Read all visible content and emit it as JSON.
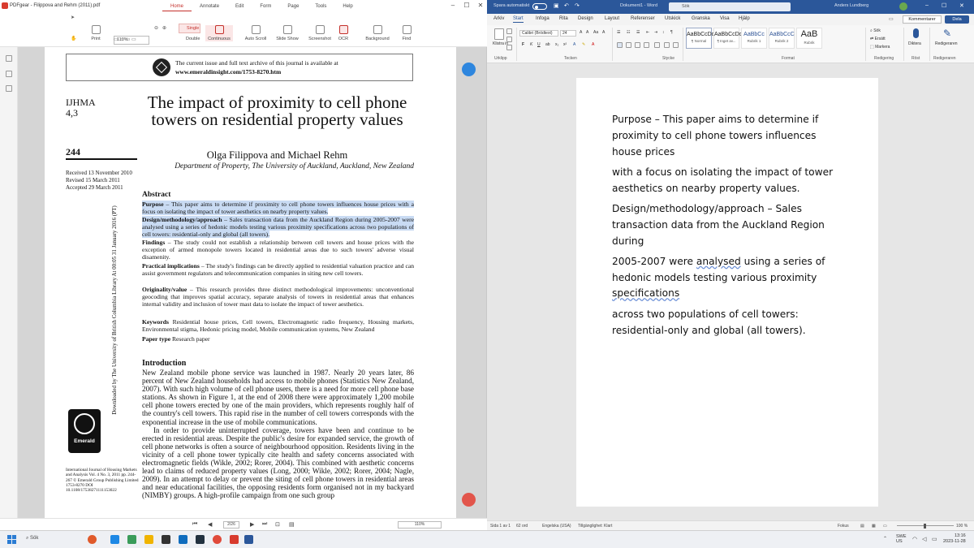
{
  "pdf": {
    "window_title": "PDFgear - Filippova and Rehm (2011).pdf",
    "menu_tabs": [
      "Home",
      "Annotate",
      "Edit",
      "Form",
      "Page",
      "Tools",
      "Help"
    ],
    "active_tab": "Home",
    "toolbar": {
      "print": "Print",
      "zoom": "110%",
      "single": "Single",
      "double": "Double",
      "continuous": "Continuous",
      "auto_scroll": "Auto Scroll",
      "slide_show": "Slide Show",
      "screenshot": "Screenshot",
      "ocr": "OCR",
      "background": "Background",
      "find": "Find"
    },
    "page": {
      "banner_line1": "The current issue and full text archive of this journal is available at",
      "banner_line2": "www.emeraldinsight.com/1753-8270.htm",
      "journal_abbr": "IJHMA",
      "journal_vol": "4,3",
      "page_number": "244",
      "received": "Received 13 November 2010",
      "revised": "Revised 15 March 2011",
      "accepted": "Accepted 29 March 2011",
      "vertical_text": "Downloaded by The University of British Columbia Library At 00:05 31 January 2016 (PT)",
      "title": "The impact of proximity to cell phone towers on residential property values",
      "authors": "Olga Filippova and Michael Rehm",
      "affiliation": "Department of Property, The University of Auckland, Auckland, New Zealand",
      "abstract_heading": "Abstract",
      "purpose_label": "Purpose",
      "purpose_text": " – This paper aims to determine if proximity to cell phone towers influences house prices with a focus on isolating the impact of tower aesthetics on nearby property values.",
      "design_label": "Design/methodology/approach",
      "design_text": " – Sales transaction data from the Auckland Region during 2005-2007 were analysed using a series of hedonic models testing various proximity specifications across two populations of cell towers: residential-only and global (all towers).",
      "findings_label": "Findings",
      "findings_text": " – The study could not establish a relationship between cell towers and house prices with the exception of armed monopole towers located in residential areas due to such towers' adverse visual disamenity.",
      "practical_label": "Practical implications",
      "practical_text": " – The study's findings can be directly applied to residential valuation practice and can assist government regulators and telecommunication companies in siting new cell towers.",
      "originality_label": "Originality/value",
      "originality_text": " – This research provides three distinct methodological improvements: unconventional geocoding that improves spatial accuracy, separate analysis of towers in residential areas that enhances internal validity and inclusion of tower mast data to isolate the impact of tower aesthetics.",
      "keywords_label": "Keywords",
      "keywords_text": " Residential house prices, Cell towers, Electromagnetic radio frequency, Housing markets, Environmental stigma, Hedonic pricing model, Mobile communication systems, New Zealand",
      "paper_type_label": "Paper type",
      "paper_type_text": " Research paper",
      "intro_heading": "Introduction",
      "intro_p1": "New Zealand mobile phone service was launched in 1987. Nearly 20 years later, 86 percent of New Zealand households had access to mobile phones (Statistics New Zealand, 2007). With such high volume of cell phone users, there is a need for more cell phone base stations. As shown in Figure 1, at the end of 2008 there were approximately 1,200 mobile cell phone towers erected by one of the main providers, which represents roughly half of the country's cell towers. This rapid rise in the number of cell towers corresponds with the exponential increase in the use of mobile communications.",
      "intro_p2": "In order to provide uninterrupted coverage, towers have been and continue to be erected in residential areas. Despite the public's desire for expanded service, the growth of cell phone networks is often a source of neighbourhood opposition. Residents living in the vicinity of a cell phone tower typically cite health and safety concerns associated with electromagnetic fields (Wikle, 2002; Rorer, 2004). This combined with aesthetic concerns lead to claims of reduced property values (Long, 2000; Wikle, 2002; Rorer, 2004; Nagle, 2009). In an attempt to delay or prevent the siting of cell phone towers in residential areas and near educational facilities, the opposing residents form organised not in my backyard (NIMBY) groups. A high-profile campaign from one such group",
      "emerald": "Emerald",
      "pub_info": "International Journal of Housing Markets and Analysis Vol. 4 No. 3, 2011 pp. 244-267 © Emerald Group Publishing Limited 1753-8270 DOI 10.1108/17538271111153022"
    },
    "status": {
      "page_current": "2",
      "page_total": "/26",
      "zoom": "110%"
    }
  },
  "word": {
    "autosave_label": "Spara automatiskt",
    "doc_name": "Dokument1 - Word",
    "search_placeholder": "Sök",
    "user": "Anders Lundberg",
    "tabs": [
      "Arkiv",
      "Start",
      "Infoga",
      "Rita",
      "Design",
      "Layout",
      "Referenser",
      "Utskick",
      "Granska",
      "Visa",
      "Hjälp"
    ],
    "active_tab": "Start",
    "comments_button": "Kommentarer",
    "share_button": "Dela",
    "ribbon": {
      "clipboard_paste": "Klistra in",
      "clipboard_group": "Urklipp",
      "font_name": "Calibri (Brödtext)",
      "font_size": "24",
      "font_group": "Tecken",
      "paragraph_group": "Stycke",
      "styles": [
        {
          "sample": "AaBbCcDd",
          "name": "¶ Normal"
        },
        {
          "sample": "AaBbCcDd",
          "name": "¶ Inget av..."
        },
        {
          "sample": "AaBbCc",
          "name": "Rubrik 1"
        },
        {
          "sample": "AaBbCcC",
          "name": "Rubrik 2"
        },
        {
          "sample": "AaB",
          "name": "Rubrik"
        }
      ],
      "styles_group": "Format",
      "find": "Sök",
      "replace": "Ersätt",
      "select": "Markera",
      "editing_group": "Redigering",
      "dictate": "Diktera",
      "voice_group": "Röst",
      "editor": "Redigeraren",
      "editor_group": "Redigeraren"
    },
    "document": {
      "p1": "Purpose – This paper aims to determine if proximity to cell phone towers influences house prices",
      "p2": "with a focus on isolating the impact of tower aesthetics on nearby property values.",
      "p3": "Design/methodology/approach – Sales transaction data from the Auckland Region during",
      "p4a": "2005-2007 were ",
      "p4b": "analysed",
      "p4c": " using a series of hedonic models testing various proximity ",
      "p4d": "specifications",
      "p5": "across two populations of cell towers: residential-only and global (all towers)."
    },
    "status": {
      "page": "Sida 1 av 1",
      "words": "62 ord",
      "language": "Engelska (USA)",
      "accessibility": "Tillgänglighet: Klart",
      "focus": "Fokus",
      "zoom": "100 %"
    }
  },
  "taskbar": {
    "search": "Sök",
    "lang": "SWE",
    "lang2": "US",
    "time": "13:16",
    "date": "2023-11-28"
  }
}
